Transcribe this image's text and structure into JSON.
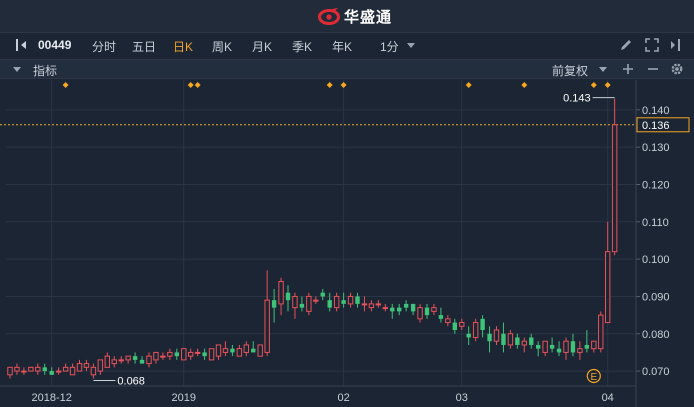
{
  "brand": {
    "name": "华盛通",
    "logo_icon": "huasheng-logo-icon"
  },
  "toolbar": {
    "stock_code": "00449",
    "periods": [
      "分时",
      "五日",
      "日K",
      "周K",
      "月K",
      "季K",
      "年K"
    ],
    "active_period": "日K",
    "interval": "1分",
    "icons": [
      "panel-toggle-icon",
      "pencil-icon",
      "fullscreen-icon",
      "sidebar-collapse-icon"
    ]
  },
  "indicator_bar": {
    "label": "指标",
    "adjust_mode": "前复权",
    "icons": [
      "collapse-triangle-icon",
      "dropdown-icon",
      "plus-icon",
      "minus-icon",
      "gear-icon"
    ]
  },
  "chart_data": {
    "type": "candlestick",
    "ylim": [
      0.066,
      0.148
    ],
    "y_ticks": [
      "0.070",
      "0.080",
      "0.090",
      "0.100",
      "0.110",
      "0.120",
      "0.130",
      "0.140"
    ],
    "x_ticks": [
      {
        "label": "2018-12",
        "index": 6
      },
      {
        "label": "2019",
        "index": 25
      },
      {
        "label": "02",
        "index": 48
      },
      {
        "label": "03",
        "index": 65
      },
      {
        "label": "04",
        "index": 86
      }
    ],
    "current_price": {
      "value": 0.136,
      "label": "0.136"
    },
    "annotations": [
      {
        "type": "max",
        "value": 0.143,
        "label": "0.143",
        "index": 87
      },
      {
        "type": "min",
        "value": 0.068,
        "label": "0.068",
        "index": 12
      }
    ],
    "event_markers": [
      8,
      26,
      27,
      46,
      48,
      66,
      74,
      84,
      86
    ],
    "event_badge": {
      "label": "E",
      "index": 84
    },
    "colors": {
      "up": "#e8525a",
      "down": "#3fc37a",
      "marker": "#f5a623",
      "price_line": "#f5a623"
    },
    "candles": [
      [
        0.069,
        0.071,
        0.071,
        0.068
      ],
      [
        0.07,
        0.071,
        0.072,
        0.069
      ],
      [
        0.07,
        0.07,
        0.071,
        0.069
      ],
      [
        0.07,
        0.071,
        0.071,
        0.07
      ],
      [
        0.07,
        0.071,
        0.072,
        0.069
      ],
      [
        0.071,
        0.07,
        0.072,
        0.069
      ],
      [
        0.07,
        0.069,
        0.071,
        0.069
      ],
      [
        0.07,
        0.07,
        0.071,
        0.069
      ],
      [
        0.07,
        0.071,
        0.072,
        0.07
      ],
      [
        0.069,
        0.071,
        0.072,
        0.069
      ],
      [
        0.07,
        0.072,
        0.073,
        0.07
      ],
      [
        0.071,
        0.072,
        0.073,
        0.07
      ],
      [
        0.069,
        0.071,
        0.072,
        0.068
      ],
      [
        0.07,
        0.073,
        0.073,
        0.069
      ],
      [
        0.071,
        0.074,
        0.075,
        0.071
      ],
      [
        0.072,
        0.073,
        0.074,
        0.071
      ],
      [
        0.073,
        0.073,
        0.074,
        0.072
      ],
      [
        0.073,
        0.074,
        0.074,
        0.072
      ],
      [
        0.074,
        0.073,
        0.075,
        0.072
      ],
      [
        0.073,
        0.072,
        0.074,
        0.072
      ],
      [
        0.072,
        0.074,
        0.075,
        0.071
      ],
      [
        0.073,
        0.075,
        0.075,
        0.072
      ],
      [
        0.074,
        0.074,
        0.075,
        0.073
      ],
      [
        0.074,
        0.075,
        0.076,
        0.073
      ],
      [
        0.075,
        0.074,
        0.076,
        0.073
      ],
      [
        0.073,
        0.076,
        0.076,
        0.073
      ],
      [
        0.074,
        0.075,
        0.076,
        0.073
      ],
      [
        0.075,
        0.075,
        0.076,
        0.074
      ],
      [
        0.075,
        0.074,
        0.076,
        0.073
      ],
      [
        0.073,
        0.076,
        0.076,
        0.073
      ],
      [
        0.074,
        0.077,
        0.077,
        0.073
      ],
      [
        0.075,
        0.076,
        0.078,
        0.074
      ],
      [
        0.076,
        0.075,
        0.077,
        0.074
      ],
      [
        0.074,
        0.076,
        0.077,
        0.074
      ],
      [
        0.075,
        0.077,
        0.078,
        0.074
      ],
      [
        0.076,
        0.075,
        0.078,
        0.075
      ],
      [
        0.074,
        0.077,
        0.077,
        0.074
      ],
      [
        0.075,
        0.089,
        0.097,
        0.074
      ],
      [
        0.089,
        0.087,
        0.092,
        0.083
      ],
      [
        0.088,
        0.094,
        0.095,
        0.085
      ],
      [
        0.091,
        0.089,
        0.093,
        0.086
      ],
      [
        0.087,
        0.09,
        0.091,
        0.084
      ],
      [
        0.088,
        0.087,
        0.09,
        0.086
      ],
      [
        0.086,
        0.09,
        0.091,
        0.085
      ],
      [
        0.089,
        0.089,
        0.09,
        0.088
      ],
      [
        0.091,
        0.09,
        0.092,
        0.089
      ],
      [
        0.089,
        0.087,
        0.091,
        0.086
      ],
      [
        0.087,
        0.09,
        0.091,
        0.086
      ],
      [
        0.089,
        0.088,
        0.091,
        0.087
      ],
      [
        0.088,
        0.09,
        0.091,
        0.087
      ],
      [
        0.09,
        0.088,
        0.091,
        0.087
      ],
      [
        0.088,
        0.088,
        0.09,
        0.086
      ],
      [
        0.087,
        0.088,
        0.089,
        0.086
      ],
      [
        0.088,
        0.088,
        0.089,
        0.087
      ],
      [
        0.087,
        0.087,
        0.088,
        0.086
      ],
      [
        0.087,
        0.086,
        0.088,
        0.084
      ],
      [
        0.087,
        0.086,
        0.088,
        0.085
      ],
      [
        0.088,
        0.087,
        0.089,
        0.086
      ],
      [
        0.088,
        0.086,
        0.088,
        0.085
      ],
      [
        0.084,
        0.087,
        0.088,
        0.083
      ],
      [
        0.087,
        0.085,
        0.088,
        0.084
      ],
      [
        0.086,
        0.087,
        0.088,
        0.085
      ],
      [
        0.085,
        0.084,
        0.087,
        0.083
      ],
      [
        0.083,
        0.084,
        0.085,
        0.082
      ],
      [
        0.083,
        0.081,
        0.084,
        0.08
      ],
      [
        0.082,
        0.083,
        0.084,
        0.081
      ],
      [
        0.08,
        0.079,
        0.082,
        0.077
      ],
      [
        0.079,
        0.083,
        0.084,
        0.078
      ],
      [
        0.084,
        0.081,
        0.085,
        0.079
      ],
      [
        0.08,
        0.078,
        0.082,
        0.075
      ],
      [
        0.078,
        0.081,
        0.082,
        0.077
      ],
      [
        0.08,
        0.077,
        0.083,
        0.075
      ],
      [
        0.077,
        0.08,
        0.081,
        0.076
      ],
      [
        0.079,
        0.077,
        0.08,
        0.076
      ],
      [
        0.077,
        0.078,
        0.079,
        0.075
      ],
      [
        0.079,
        0.077,
        0.08,
        0.076
      ],
      [
        0.077,
        0.076,
        0.078,
        0.074
      ],
      [
        0.075,
        0.078,
        0.078,
        0.074
      ],
      [
        0.077,
        0.076,
        0.079,
        0.075
      ],
      [
        0.076,
        0.075,
        0.078,
        0.074
      ],
      [
        0.075,
        0.078,
        0.079,
        0.073
      ],
      [
        0.078,
        0.075,
        0.08,
        0.074
      ],
      [
        0.075,
        0.076,
        0.078,
        0.073
      ],
      [
        0.077,
        0.076,
        0.081,
        0.075
      ],
      [
        0.076,
        0.078,
        0.078,
        0.075
      ],
      [
        0.076,
        0.085,
        0.086,
        0.075
      ],
      [
        0.083,
        0.102,
        0.11,
        0.083
      ],
      [
        0.102,
        0.136,
        0.143,
        0.101
      ]
    ]
  }
}
